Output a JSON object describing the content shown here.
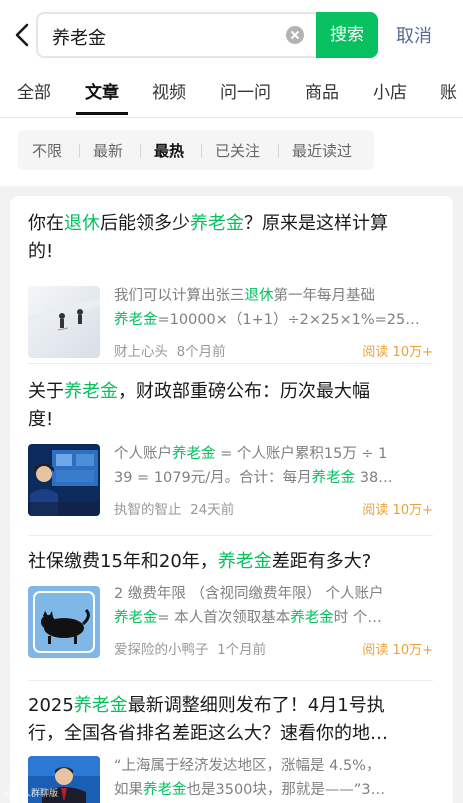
{
  "search": {
    "query": "养老金",
    "button": "搜索",
    "cancel": "取消"
  },
  "tabs": [
    "全部",
    "文章",
    "视频",
    "问一问",
    "商品",
    "小店",
    "账"
  ],
  "filters": [
    "不限",
    "最新",
    "最热",
    "已关注",
    "最近读过"
  ],
  "articles": [
    {
      "title": [
        [
          "你在",
          ""
        ],
        [
          "退休",
          "hl"
        ],
        [
          "后能领多少",
          ""
        ],
        [
          "养老金",
          "hl"
        ],
        [
          "？原来是这样计算",
          ""
        ]
      ],
      "title_line2": "的!",
      "snippet1": [
        [
          "我们可以计算出张三",
          ""
        ],
        [
          "退休",
          "hl"
        ],
        [
          "第一年每月基础",
          ""
        ]
      ],
      "snippet2": [
        [
          "养老金",
          "hl"
        ],
        [
          "=10000×（1+1）÷2×25×1%=25…",
          ""
        ]
      ],
      "source": "财上心头",
      "time": "8个月前",
      "reads": "阅读 10万+"
    },
    {
      "title": [
        [
          "关于",
          ""
        ],
        [
          "养老金",
          "hl"
        ],
        [
          "，财政部重磅公布：历次最大幅",
          ""
        ]
      ],
      "title_line2": "度!",
      "snippet1": [
        [
          "个人账户",
          ""
        ],
        [
          "养老金",
          "hl"
        ],
        [
          " = 个人账户累积15万 ÷ 1",
          ""
        ]
      ],
      "snippet2": [
        [
          "39 = 1079元/月。合计：每月",
          ""
        ],
        [
          "养老金",
          "hl"
        ],
        [
          " 38…",
          ""
        ]
      ],
      "source": "执智的智止",
      "time": "24天前",
      "reads": "阅读 10万+"
    },
    {
      "title": [
        [
          "社保缴费15年和20年，",
          ""
        ],
        [
          "养老金",
          "hl"
        ],
        [
          "差距有多大?",
          ""
        ]
      ],
      "title_line2": "",
      "snippet1": [
        [
          "2 缴费年限 （含视同缴费年限） 个人账户",
          ""
        ]
      ],
      "snippet2": [
        [
          "养老金",
          "hl"
        ],
        [
          "= 本人首次领取基本",
          ""
        ],
        [
          "养老金",
          "hl"
        ],
        [
          "时 个…",
          ""
        ]
      ],
      "source": "爱探险的小鸭子",
      "time": "1个月前",
      "reads": "阅读 10万+"
    },
    {
      "title": [
        [
          "2025",
          ""
        ],
        [
          "养老金",
          "hl"
        ],
        [
          "最新调整细则发布了！4月1号执",
          ""
        ]
      ],
      "title_line2": "行，全国各省排名差距这么大？速看你的地…",
      "snippet1": [
        [
          "“上海属于经济发达地区，涨幅是 4.5%，",
          ""
        ]
      ],
      "snippet2": [
        [
          "如果",
          ""
        ],
        [
          "养老金",
          "hl"
        ],
        [
          "也是3500块，那就是——”3…",
          ""
        ]
      ],
      "source": "",
      "time": "",
      "reads": ""
    }
  ],
  "watermark": "@一人群聊版",
  "colors": {
    "accent": "#07c160",
    "link": "#576b95",
    "reads": "#e8a23a"
  }
}
